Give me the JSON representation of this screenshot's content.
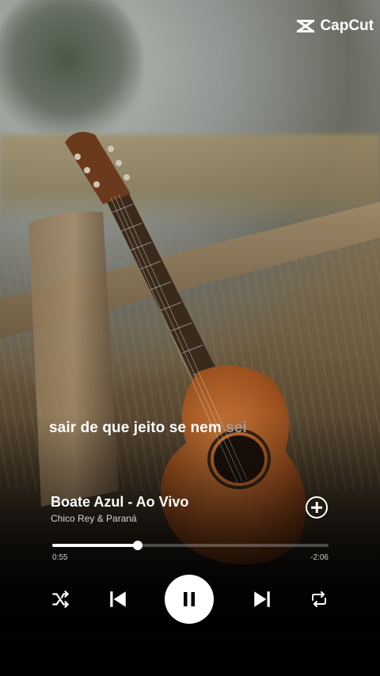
{
  "watermark": {
    "brand": "CapCut",
    "icon": "capcut-logo-icon"
  },
  "lyrics": {
    "current": "sair de que jeito se nem",
    "upcoming": "sei"
  },
  "track": {
    "title": "Boate Azul - Ao Vivo",
    "artist": "Chico Rey & Paraná"
  },
  "progress": {
    "elapsed": "0:55",
    "remaining": "-2:06",
    "fraction": 0.31
  },
  "controls": {
    "shuffle": "shuffle-icon",
    "previous": "skip-previous-icon",
    "play_pause": "pause-icon",
    "next": "skip-next-icon",
    "repeat": "repeat-icon",
    "add": "add-circle-icon"
  },
  "colors": {
    "text": "#ffffff",
    "muted_lyric": "#9a9a9a",
    "guitar": "#b5622b"
  }
}
